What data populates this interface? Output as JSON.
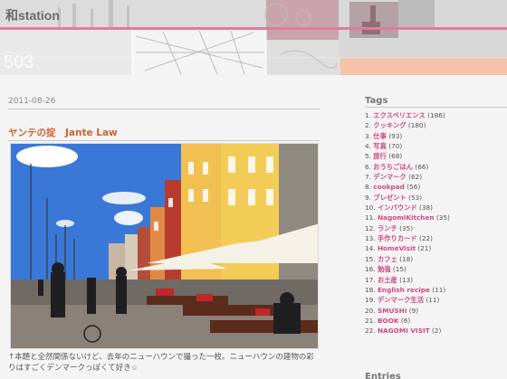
{
  "site": {
    "title": "和station",
    "banner_number": "503"
  },
  "post": {
    "date": "2011-08-26",
    "title": "ヤンテの掟　Jante Law",
    "body": "↑本題と全然関係ないけど、去年のニューハウンで撮った一枚。ニューハウンの建物の彩りはすごくデンマークっぽくて好き☆"
  },
  "sidebar": {
    "tags_title": "Tags",
    "tags": [
      {
        "num": "1.",
        "name": "エクスペリエンス",
        "count": "(186)"
      },
      {
        "num": "2.",
        "name": "クッキング",
        "count": "(180)"
      },
      {
        "num": "3.",
        "name": "仕事",
        "count": "(93)"
      },
      {
        "num": "4.",
        "name": "写真",
        "count": "(70)"
      },
      {
        "num": "5.",
        "name": "旅行",
        "count": "(68)"
      },
      {
        "num": "6.",
        "name": "おうちごはん",
        "count": "(66)"
      },
      {
        "num": "7.",
        "name": "デンマーク",
        "count": "(62)"
      },
      {
        "num": "8.",
        "name": "cookpad",
        "count": "(56)"
      },
      {
        "num": "9.",
        "name": "プレゼント",
        "count": "(53)"
      },
      {
        "num": "10.",
        "name": "インバウンド",
        "count": "(38)"
      },
      {
        "num": "11.",
        "name": "NagomiKitchen",
        "count": "(35)"
      },
      {
        "num": "12.",
        "name": "ランチ",
        "count": "(35)"
      },
      {
        "num": "13.",
        "name": "手作りカード",
        "count": "(22)"
      },
      {
        "num": "14.",
        "name": "HomeVisit",
        "count": "(21)"
      },
      {
        "num": "15.",
        "name": "カフェ",
        "count": "(18)"
      },
      {
        "num": "16.",
        "name": "勉強",
        "count": "(15)"
      },
      {
        "num": "17.",
        "name": "お土産",
        "count": "(13)"
      },
      {
        "num": "18.",
        "name": "English recipe",
        "count": "(11)"
      },
      {
        "num": "19.",
        "name": "デンマーク生活",
        "count": "(11)"
      },
      {
        "num": "20.",
        "name": "SMUSHI",
        "count": "(9)"
      },
      {
        "num": "21.",
        "name": "BOOK",
        "count": "(6)"
      },
      {
        "num": "22.",
        "name": "NAGOMI VISIT",
        "count": "(2)"
      }
    ],
    "entries_title": "Entries"
  },
  "colors": {
    "accent_pink": "#d04a86",
    "title_orange": "#d0632e",
    "banner_pink_strip": "#e07aa0",
    "banner_peach": "#f4c3a8"
  },
  "icons": [
    "nyhavn-photo"
  ]
}
